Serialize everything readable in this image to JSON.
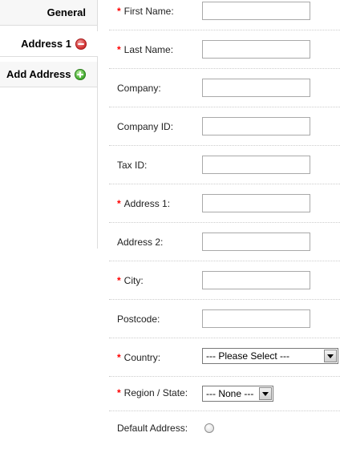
{
  "tabs": {
    "general": "General",
    "address1": "Address 1",
    "add_address": "Add Address"
  },
  "form": {
    "required_marker": "*",
    "first_name": {
      "label": "First Name:",
      "value": ""
    },
    "last_name": {
      "label": "Last Name:",
      "value": ""
    },
    "company": {
      "label": "Company:",
      "value": ""
    },
    "company_id": {
      "label": "Company ID:",
      "value": ""
    },
    "tax_id": {
      "label": "Tax ID:",
      "value": ""
    },
    "address_1": {
      "label": "Address 1:",
      "value": ""
    },
    "address_2": {
      "label": "Address 2:",
      "value": ""
    },
    "city": {
      "label": "City:",
      "value": ""
    },
    "postcode": {
      "label": "Postcode:",
      "value": ""
    },
    "country": {
      "label": "Country:",
      "selected": "--- Please Select ---"
    },
    "region": {
      "label": "Region / State:",
      "selected": "--- None ---"
    },
    "default_address": {
      "label": "Default Address:",
      "checked": false
    }
  },
  "colors": {
    "required": "#ff0000",
    "border": "#dddddd",
    "remove_icon": "#d53a3a",
    "add_icon": "#4fb43a"
  },
  "icons": {
    "remove": "remove-circle-icon",
    "add": "add-circle-icon"
  }
}
